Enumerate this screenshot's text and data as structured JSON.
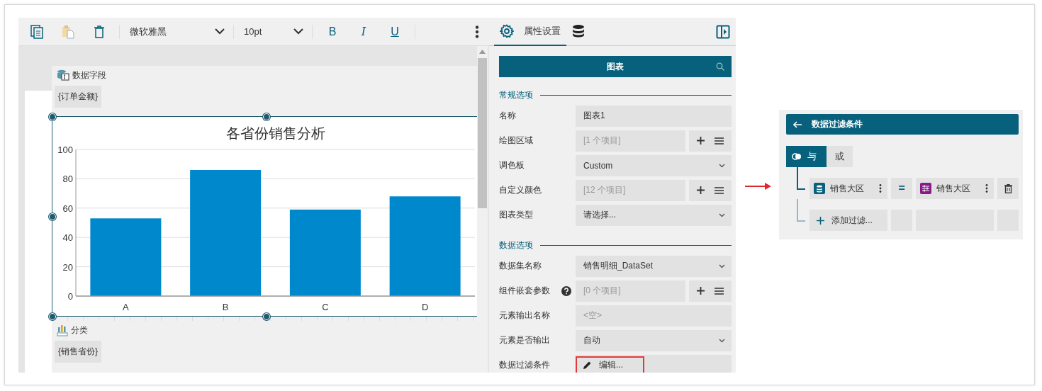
{
  "toolbar": {
    "buttons": [
      {
        "kind": "copy",
        "disabled": false
      },
      {
        "kind": "paste",
        "disabled": true
      },
      {
        "kind": "delete",
        "disabled": false
      }
    ],
    "font": "微软雅黑",
    "size": "10pt",
    "format_buttons": [
      {
        "kind": "bold",
        "label": "B"
      },
      {
        "kind": "italic",
        "label": "I"
      },
      {
        "kind": "underline",
        "label": "U"
      }
    ]
  },
  "designer": {
    "value_zone": {
      "title": "数据字段",
      "chip": "{订单金额}"
    },
    "chart_data": {
      "type": "bar",
      "title": "各省份销售分析",
      "categories": [
        "A",
        "B",
        "C",
        "D"
      ],
      "series": [
        {
          "color": "#0088cc",
          "values": [
            53,
            86,
            59,
            68
          ]
        }
      ],
      "grid": true,
      "ylim": [
        0,
        100
      ],
      "yticks": [
        0,
        20,
        40,
        60,
        80,
        100
      ]
    },
    "category_zone": {
      "title": "分类",
      "chip": "{销售省份}"
    }
  },
  "panel": {
    "tabs": [
      {
        "kind": "properties",
        "label": "属性设置",
        "selected": true
      },
      {
        "kind": "data",
        "selected": false
      }
    ],
    "header": "图表",
    "sections": [
      {
        "title": "常规选项",
        "rows": [
          {
            "label": "名称",
            "kind": "text",
            "value": "图表1"
          },
          {
            "label": "绘图区域",
            "kind": "collection",
            "placeholder": "[1 个项目]"
          },
          {
            "label": "调色板",
            "kind": "select",
            "value": "Custom"
          },
          {
            "label": "自定义颜色",
            "kind": "collection",
            "placeholder": "[12 个项目]"
          },
          {
            "label": "图表类型",
            "kind": "select",
            "value": "请选择..."
          }
        ]
      },
      {
        "title": "数据选项",
        "rows": [
          {
            "label": "数据集名称",
            "kind": "select",
            "value": "销售明细_DataSet"
          },
          {
            "label": "组件嵌套参数",
            "kind": "collection",
            "placeholder": "[0 个项目]",
            "help": true
          },
          {
            "label": "元素输出名称",
            "kind": "empty",
            "placeholder": "<空>"
          },
          {
            "label": "元素是否输出",
            "kind": "select",
            "value": "自动"
          },
          {
            "label": "数据过滤条件",
            "kind": "edit",
            "value": "编辑...",
            "highlighted": true
          }
        ]
      }
    ]
  },
  "filter": {
    "title": "数据过滤条件",
    "logic": [
      {
        "label": "与",
        "selected": true
      },
      {
        "label": "或",
        "selected": false
      }
    ],
    "conditions": [
      {
        "left": "销售大区",
        "operator": "=",
        "right": "销售大区"
      }
    ],
    "add": "添加过滤..."
  }
}
